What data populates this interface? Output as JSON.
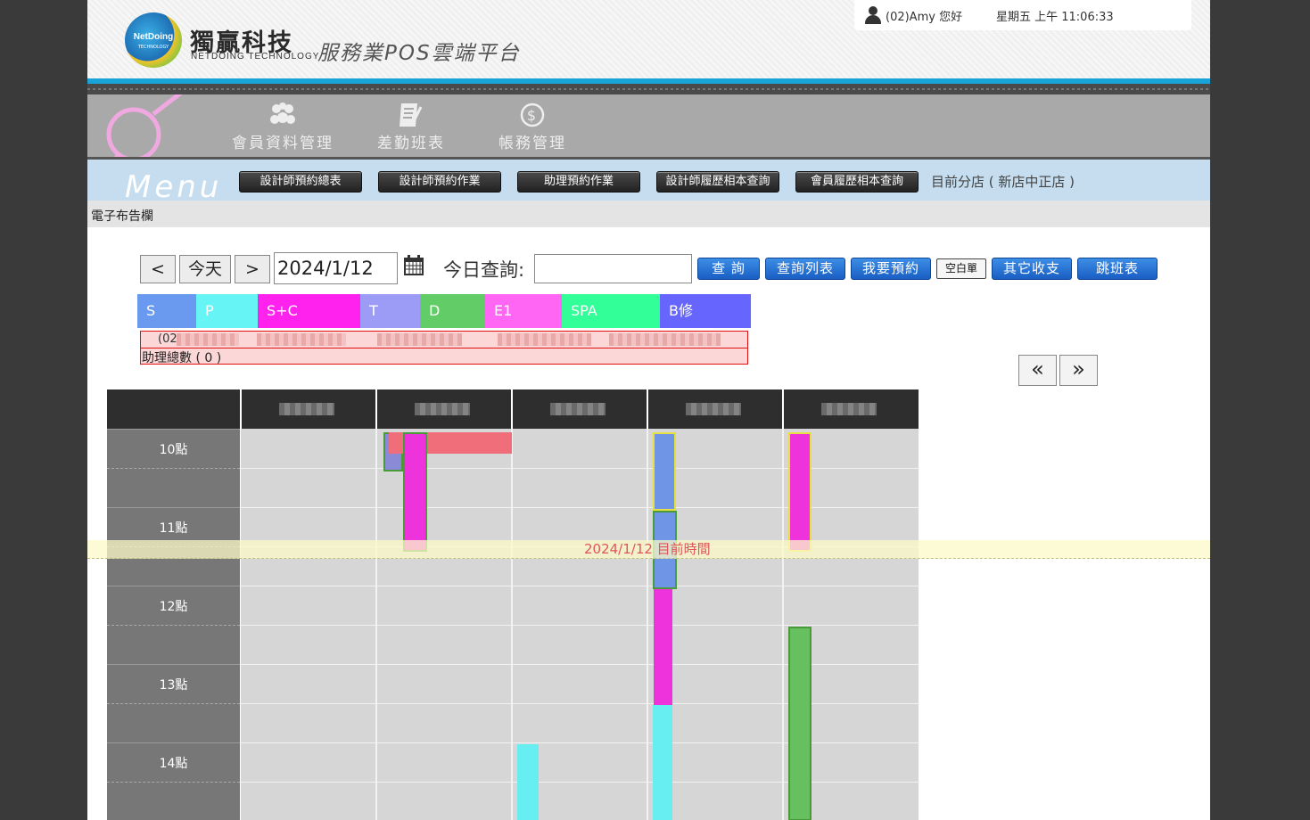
{
  "header": {
    "logo_text": "NetDoing",
    "logo_sub": "TECHNOLOGY",
    "brand_cn": "獨贏科技",
    "brand_en": "NETDOING TECHNOLOGY",
    "slogan": "服務業POS雲端平台",
    "greeting": "(02)Amy 您好",
    "clock": "星期五 上午 11:06:33"
  },
  "nav": {
    "items": [
      {
        "label": "會員資料管理",
        "icon": "members-icon"
      },
      {
        "label": "差勤班表",
        "icon": "schedule-icon"
      },
      {
        "label": "帳務管理",
        "icon": "dollar-icon"
      }
    ]
  },
  "menu": {
    "word": "Menu",
    "buttons": [
      "設計師預約總表",
      "設計師預約作業",
      "助理預約作業",
      "設計師履歷相本查詢",
      "會員履歷相本查詢"
    ],
    "branch": "目前分店 ( 新店中正店 )"
  },
  "bulletin": {
    "label": "電子布告欄"
  },
  "toolbar": {
    "prev": "<",
    "today": "今天",
    "next": ">",
    "date": "2024/1/12",
    "query_label": "今日查詢:",
    "query_value": "",
    "buttons": [
      "查 詢",
      "查詢列表",
      "我要預約",
      "空白單",
      "其它收支",
      "跳班表"
    ]
  },
  "legend": [
    {
      "label": "S",
      "color": "#6a9af0"
    },
    {
      "label": "P",
      "color": "#66f4f4"
    },
    {
      "label": "S+C",
      "color": "#ff22ee"
    },
    {
      "label": "T",
      "color": "#9c9cf6"
    },
    {
      "label": "D",
      "color": "#62cc66"
    },
    {
      "label": "E1",
      "color": "#ff66f4"
    },
    {
      "label": "SPA",
      "color": "#33ff99"
    },
    {
      "label": "B修",
      "color": "#6666ff"
    }
  ],
  "summary": {
    "prefix": "(02",
    "assistants": "助理總數 ( 0 )"
  },
  "pager": {
    "prev": "«",
    "next": "»"
  },
  "schedule": {
    "hours": [
      "10點",
      "11點",
      "12點",
      "13點",
      "14點"
    ],
    "now_label": "2024/1/12 目前時間"
  }
}
